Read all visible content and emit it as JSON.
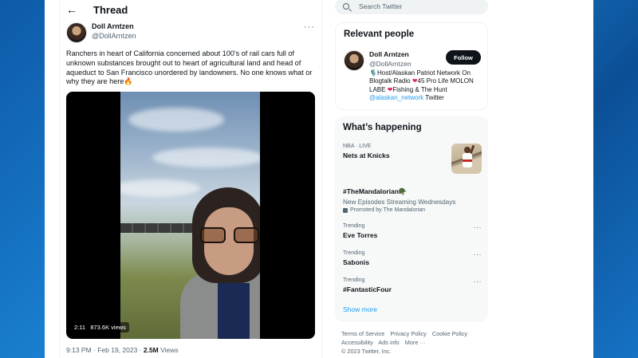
{
  "thread": {
    "title": "Thread",
    "author_name": "Doll Arntzen",
    "author_handle": "@DollArntzen",
    "text": "Ranchers in heart of California concerned about 100’s of rail cars full of unknown substances brought out to heart of agricultural land and head of aqueduct to San Francisco unordered by landowners. No one knows what or why they are here🔥",
    "video_duration": "2:11",
    "video_views": "873.6K views",
    "timestamp": "9:13 PM · Feb 19, 2023 · ",
    "total_views": "2.5M",
    "views_label": " Views"
  },
  "search": {
    "placeholder": "Search Twitter"
  },
  "relevant": {
    "title": "Relevant people",
    "name": "Doll Arntzen",
    "handle": "@DollArntzen",
    "follow_label": "Follow",
    "bio_part1": "🎙️Host/Alaskan Patriot Network On Blogtalk Radio ",
    "bio_part2": "45 Pro Life MOLON LABE ",
    "bio_part3": "Fishing & The Hunt ",
    "bio_link": "@alaskan_network",
    "bio_tail": " Twitter"
  },
  "happening": {
    "title": "What’s happening",
    "trends": [
      {
        "category": "NBA · LIVE",
        "name": "Nets at Knicks"
      },
      {
        "name": "#TheMandalorian🪖",
        "sub": "New Episodes Streaming Wednesdays",
        "promo": "Promoted by The Mandalorian"
      },
      {
        "category": "Trending",
        "name": "Eve Torres"
      },
      {
        "category": "Trending",
        "name": "Sabonis"
      },
      {
        "category": "Trending",
        "name": "#FantasticFour"
      }
    ],
    "show_more": "Show more"
  },
  "footer": {
    "links": [
      "Terms of Service",
      "Privacy Policy",
      "Cookie Policy",
      "Accessibility",
      "Ads info",
      "More ···"
    ],
    "copyright": "© 2023 Twitter, Inc."
  }
}
